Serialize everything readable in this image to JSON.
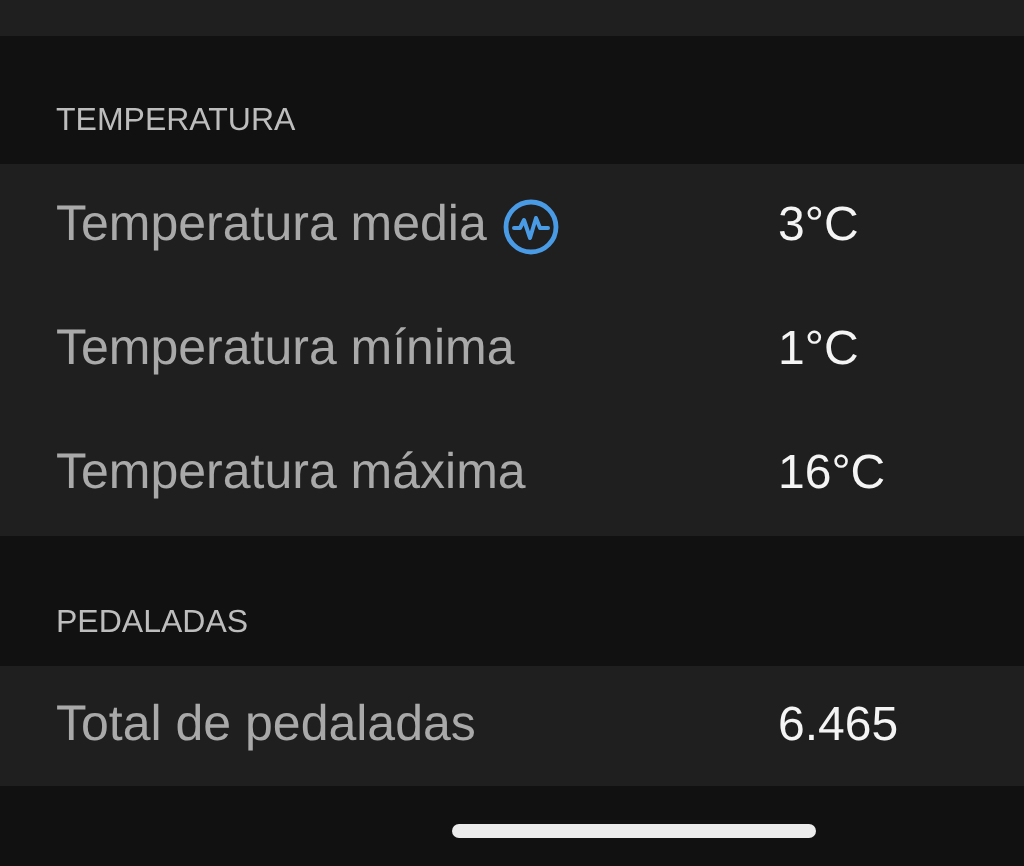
{
  "sections": [
    {
      "title": "TEMPERATURA",
      "rows": [
        {
          "label": "Temperatura media",
          "value": "3°C",
          "badge": true
        },
        {
          "label": "Temperatura mínima",
          "value": "1°C",
          "badge": false
        },
        {
          "label": "Temperatura máxima",
          "value": "16°C",
          "badge": false
        }
      ]
    },
    {
      "title": "PEDALADAS",
      "rows": [
        {
          "label": "Total de pedaladas",
          "value": "6.465",
          "badge": false
        }
      ]
    }
  ]
}
